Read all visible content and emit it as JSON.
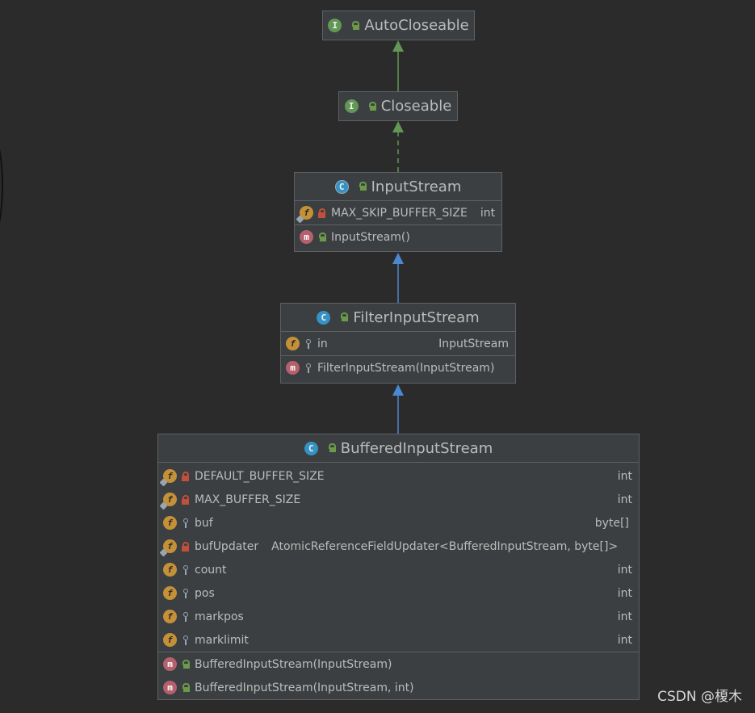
{
  "nodes": {
    "autocloseable": {
      "title": "AutoCloseable"
    },
    "closeable": {
      "title": "Closeable"
    },
    "inputstream": {
      "title": "InputStream",
      "fields": [
        {
          "name": "MAX_SKIP_BUFFER_SIZE",
          "type": "int"
        }
      ],
      "methods": [
        {
          "name": "InputStream()"
        }
      ]
    },
    "filterinputstream": {
      "title": "FilterInputStream",
      "fields": [
        {
          "name": "in",
          "type": "InputStream"
        }
      ],
      "methods": [
        {
          "name": "FilterInputStream(InputStream)"
        }
      ]
    },
    "bufferedinputstream": {
      "title": "BufferedInputStream",
      "fields": [
        {
          "name": "DEFAULT_BUFFER_SIZE",
          "type": "int"
        },
        {
          "name": "MAX_BUFFER_SIZE",
          "type": "int"
        },
        {
          "name": "buf",
          "type": "byte[]"
        },
        {
          "name": "bufUpdater",
          "type": "AtomicReferenceFieldUpdater<BufferedInputStream, byte[]>"
        },
        {
          "name": "count",
          "type": "int"
        },
        {
          "name": "pos",
          "type": "int"
        },
        {
          "name": "markpos",
          "type": "int"
        },
        {
          "name": "marklimit",
          "type": "int"
        }
      ],
      "methods": [
        {
          "name": "BufferedInputStream(InputStream)"
        },
        {
          "name": "BufferedInputStream(InputStream, int)"
        }
      ]
    }
  },
  "icons": {
    "interface": "I",
    "class": "C",
    "field": "f",
    "method": "m"
  },
  "colors": {
    "background": "#2b2b2b",
    "node_fill": "#3c3f41",
    "extends_interface_edge": "#629755",
    "extends_class_edge": "#4a88d0"
  },
  "watermark": "CSDN @榎木"
}
